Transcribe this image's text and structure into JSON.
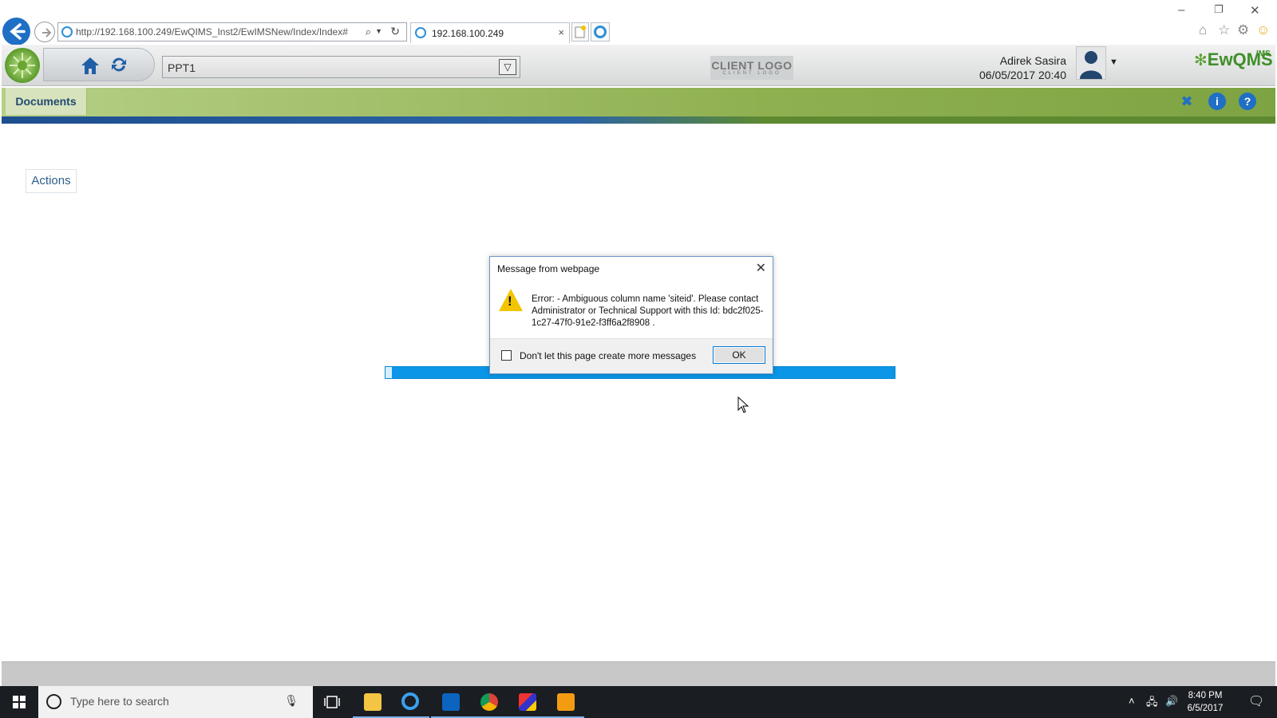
{
  "browser": {
    "url": "http://192.168.100.249/EwQIMS_Inst2/EwIMSNew/Index/Index#",
    "tab_title": "192.168.100.249",
    "tab_close": "×",
    "window_controls": [
      "–",
      "❐",
      "✕"
    ],
    "toolbar_icons": [
      "home-icon",
      "star-icon",
      "gear-icon",
      "smiley-icon"
    ]
  },
  "header": {
    "project_select_value": "PPT1",
    "client_logo": "CLIENT LOGO",
    "client_logo_sub": "CLIENT LOGO",
    "user_name": "Adirek Sasira",
    "user_datetime": "06/05/2017 20:40",
    "brand": "EwQMS",
    "brand_sup": "IMS"
  },
  "module_bar": {
    "tab_label": "Documents",
    "icons": [
      "pin-icon",
      "info-icon",
      "help-icon"
    ],
    "info_glyph": "i",
    "help_glyph": "?"
  },
  "content": {
    "actions_label": "Actions",
    "progress_color": "#0b96e8"
  },
  "dialog": {
    "title": "Message from webpage",
    "close_glyph": "✕",
    "message": "Error: - Ambiguous column name 'siteid'. Please contact Administrator or Technical Support with this Id: bdc2f025-1c27-47f0-91e2-f3ff6a2f8908 .",
    "checkbox_label": "Don't let this page create more messages",
    "ok_label": "OK"
  },
  "taskbar": {
    "search_placeholder": "Type here to search",
    "apps": [
      "task-view",
      "file-explorer",
      "internet-explorer",
      "outlook",
      "chrome",
      "paint",
      "media-player"
    ],
    "time": "8:40 PM",
    "date": "6/5/2017"
  },
  "colors": {
    "accent_blue": "#1f6fc5",
    "module_green": "#8fb050",
    "progress_blue": "#0b96e8"
  }
}
